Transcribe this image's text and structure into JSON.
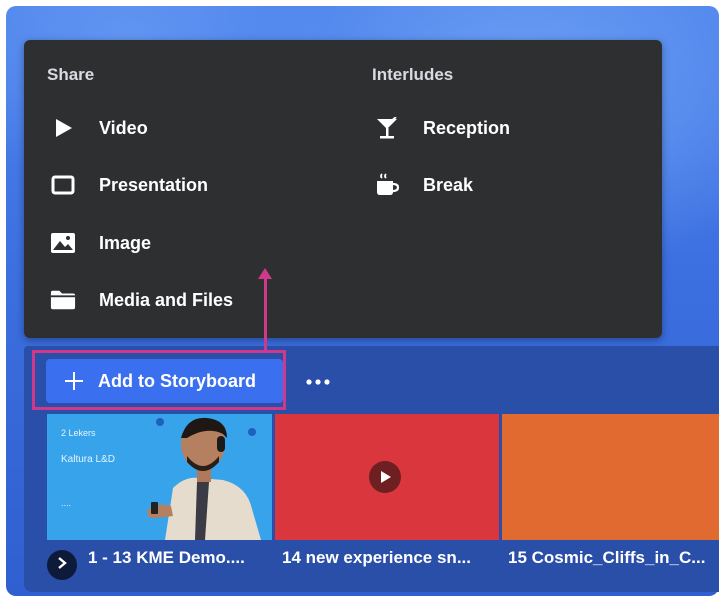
{
  "menu": {
    "share": {
      "title": "Share",
      "items": [
        {
          "label": "Video",
          "icon": "play-icon"
        },
        {
          "label": "Presentation",
          "icon": "presentation-icon"
        },
        {
          "label": "Image",
          "icon": "image-icon"
        },
        {
          "label": "Media and Files",
          "icon": "folder-icon"
        }
      ]
    },
    "interludes": {
      "title": "Interludes",
      "items": [
        {
          "label": "Reception",
          "icon": "cocktail-icon"
        },
        {
          "label": "Break",
          "icon": "coffee-icon"
        }
      ]
    }
  },
  "toolbar": {
    "add_label": "Add to Storyboard",
    "more_icon": "more-icon"
  },
  "storyboard": {
    "items": [
      {
        "caption": "1 - 13 KME Demo....",
        "thumb_text_top": "2 Lekers",
        "thumb_text_mid": "Kaltura L&D",
        "thumb_text_bottom": "....",
        "color": "#37a3ea"
      },
      {
        "caption": "14 new experience sn...",
        "color": "#d9373d"
      },
      {
        "caption": "15 Cosmic_Cliffs_in_C...",
        "color": "#e06a30"
      }
    ]
  },
  "colors": {
    "accent": "#3a6ff0",
    "highlight": "#d0388a",
    "panel": "#2e2f31"
  }
}
